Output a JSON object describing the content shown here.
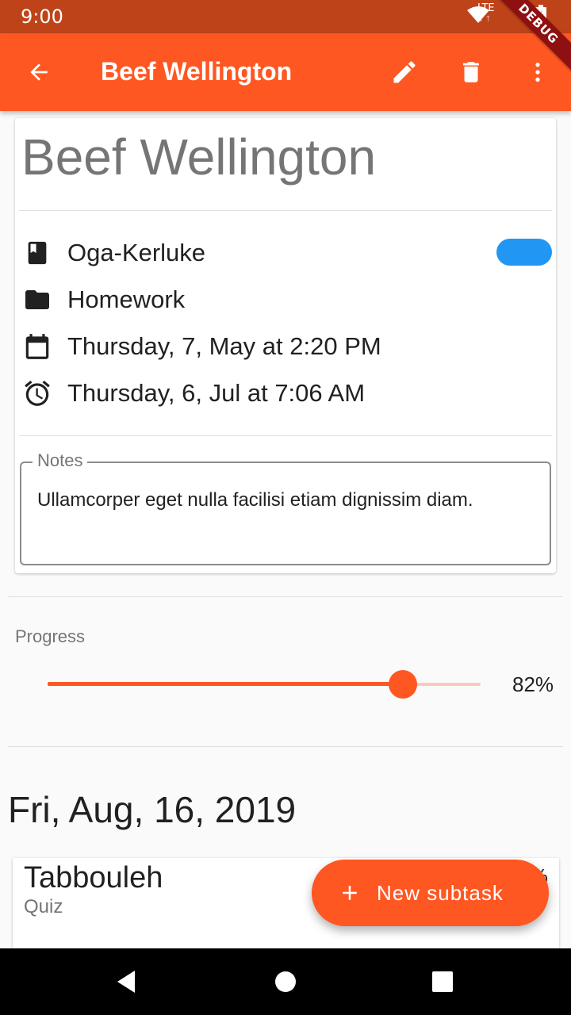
{
  "status_bar": {
    "time": "9:00",
    "network": "LTE"
  },
  "debug_banner": {
    "label": "DEBUG"
  },
  "app_bar": {
    "title": "Beef Wellington"
  },
  "detail": {
    "title": "Beef Wellington",
    "project": "Oga-Kerluke",
    "project_color": "#2196f3",
    "category": "Homework",
    "due_date": "Thursday, 7, May at 2:20 PM",
    "reminder": "Thursday, 6, Jul at 7:06 AM",
    "notes_label": "Notes",
    "notes_value": "Ullamcorper eget nulla facilisi etiam dignissim diam."
  },
  "progress": {
    "label": "Progress",
    "value": 0.82,
    "value_text": "82%"
  },
  "subtasks": {
    "date_header": "Fri, Aug, 16, 2019",
    "items": [
      {
        "title": "Tabbouleh",
        "subtitle": "Quiz",
        "trailing": "%"
      }
    ]
  },
  "fab": {
    "label": "New subtask"
  },
  "colors": {
    "primary": "#ff5722",
    "primary_dark": "#bf4319",
    "accent": "#2196f3"
  }
}
